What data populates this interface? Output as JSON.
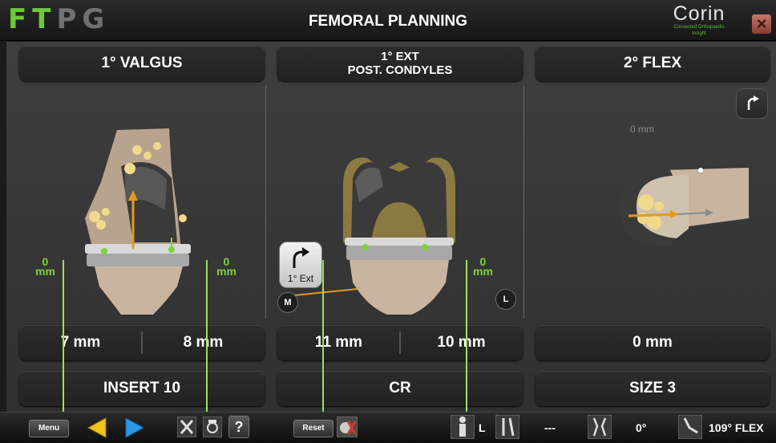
{
  "app_logo": {
    "letters": [
      "F",
      "T",
      "P",
      "G"
    ]
  },
  "header": {
    "title": "FEMORAL PLANNING"
  },
  "brand": {
    "name": "Corin",
    "tagline": "Connected Orthopaedic Insight"
  },
  "panels": {
    "left": {
      "header": "1° VALGUS",
      "gap_medial": "7 mm",
      "gap_lateral": "8 mm",
      "footer": "INSERT 10",
      "mm_left": {
        "value": "0",
        "unit": "mm"
      },
      "mm_right": {
        "value": "0",
        "unit": "mm"
      }
    },
    "center": {
      "header_line1": "1° EXT",
      "header_line2": "POST. CONDYLES",
      "gap_medial": "11 mm",
      "gap_lateral": "10 mm",
      "footer": "CR",
      "mm_left": {
        "value": "0",
        "unit": "mm"
      },
      "mm_right": {
        "value": "0",
        "unit": "mm"
      },
      "ext_button_label": "1° Ext",
      "side_m": "M",
      "side_l": "L"
    },
    "right": {
      "header": "2° FLEX",
      "gap": "0 mm",
      "footer": "SIZE 3",
      "distance_label": "0 mm"
    }
  },
  "toolbar": {
    "menu_label": "Menu",
    "reset_label": "Reset",
    "help_label": "?",
    "side": "L",
    "alignment_value": "---",
    "angle_value": "0°",
    "flex_value": "109° FLEX"
  },
  "colors": {
    "accent_green": "#6ec83a",
    "arrow_orange": "#e39a1c",
    "close_red": "#b04a40"
  }
}
